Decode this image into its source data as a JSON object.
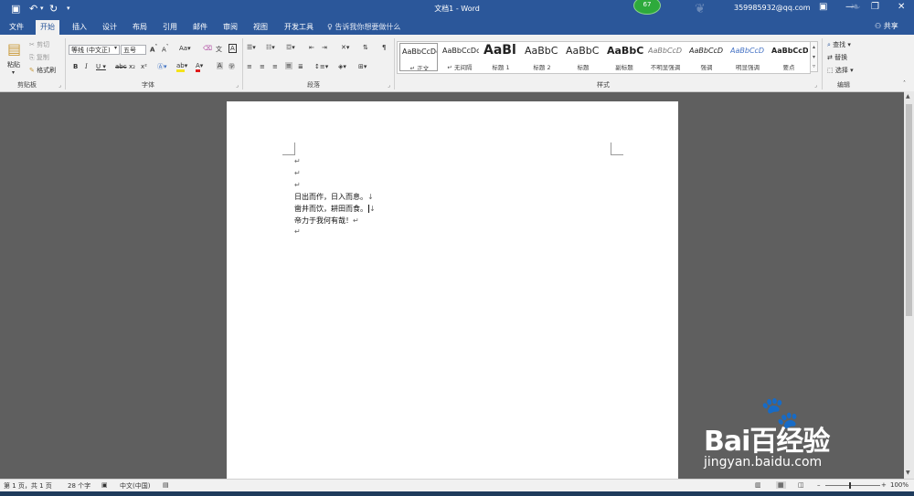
{
  "window": {
    "title": "文档1 - Word",
    "user": "359985932@qq.com",
    "badge_count": "67"
  },
  "tabs": [
    "文件",
    "开始",
    "插入",
    "设计",
    "布局",
    "引用",
    "邮件",
    "审阅",
    "视图",
    "开发工具"
  ],
  "tell_me": "告诉我你想要做什么",
  "share": "共享",
  "clipboard": {
    "paste": "粘贴",
    "cut": "剪切",
    "copy": "复制",
    "format_painter": "格式刷",
    "group": "剪贴板"
  },
  "font": {
    "name": "等线 (中文正)",
    "size": "五号",
    "group": "字体"
  },
  "paragraph": {
    "group": "段落"
  },
  "styles": {
    "group": "样式",
    "items": [
      {
        "sample": "AaBbCcDc",
        "name": "↵ 正文"
      },
      {
        "sample": "AaBbCcDc",
        "name": "↵ 无间隔"
      },
      {
        "sample": "AaBl",
        "name": "标题 1"
      },
      {
        "sample": "AaBbC",
        "name": "标题 2"
      },
      {
        "sample": "AaBbC",
        "name": "标题"
      },
      {
        "sample": "AaBbC",
        "name": "副标题"
      },
      {
        "sample": "AaBbCcD",
        "name": "不明显强调"
      },
      {
        "sample": "AaBbCcD",
        "name": "强调"
      },
      {
        "sample": "AaBbCcD",
        "name": "明显强调"
      },
      {
        "sample": "AaBbCcD",
        "name": "要点"
      }
    ]
  },
  "editing": {
    "find": "查找",
    "replace": "替换",
    "select": "选择",
    "group": "编辑"
  },
  "document": {
    "lines": [
      "",
      "",
      "",
      "日出而作，日入而息。",
      "凿井而饮，耕田而食。",
      "帝力于我何有哉！",
      ""
    ]
  },
  "status": {
    "page": "第 1 页，共 1 页",
    "words": "28 个字",
    "language": "中文(中国)",
    "zoom": "100%"
  },
  "watermark": {
    "brand": "Bai百经验",
    "url": "jingyan.baidu.com"
  }
}
